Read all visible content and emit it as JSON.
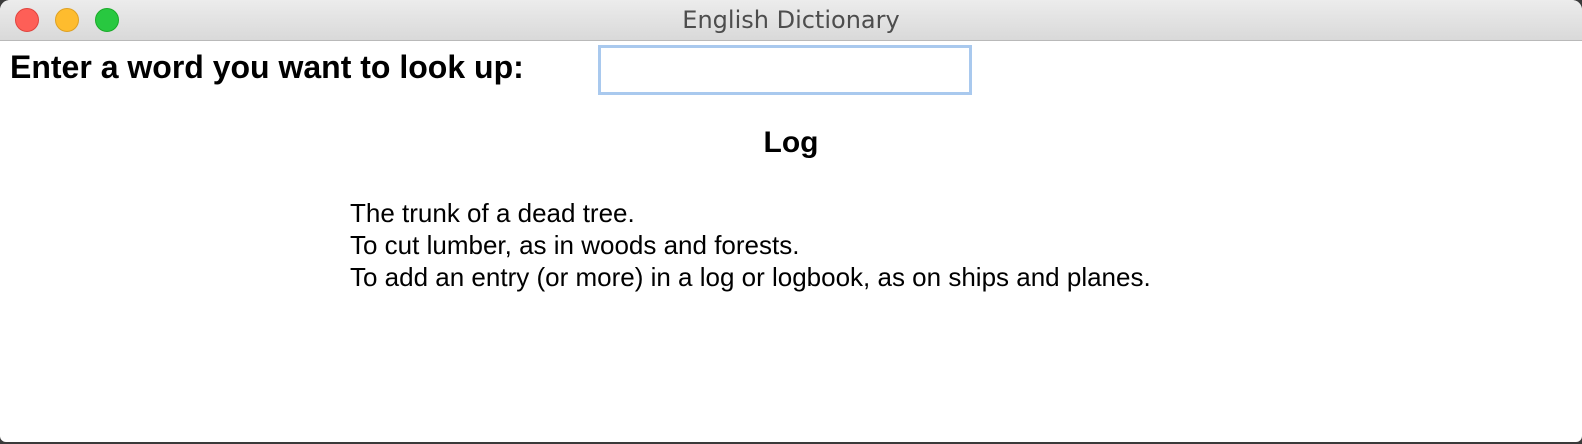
{
  "window": {
    "title": "English Dictionary"
  },
  "search": {
    "label": "Enter a word you want to look up:",
    "value": "",
    "placeholder": ""
  },
  "result": {
    "word": "Log",
    "definitions": [
      "The trunk of a dead tree.",
      "To cut lumber, as in woods and forests.",
      "To add an entry (or more) in a log or logbook, as on ships and planes."
    ]
  },
  "colors": {
    "close": "#fe5f57",
    "minimize": "#febc2e",
    "zoom": "#28c840",
    "input_focus_border": "#a9c9ee"
  }
}
